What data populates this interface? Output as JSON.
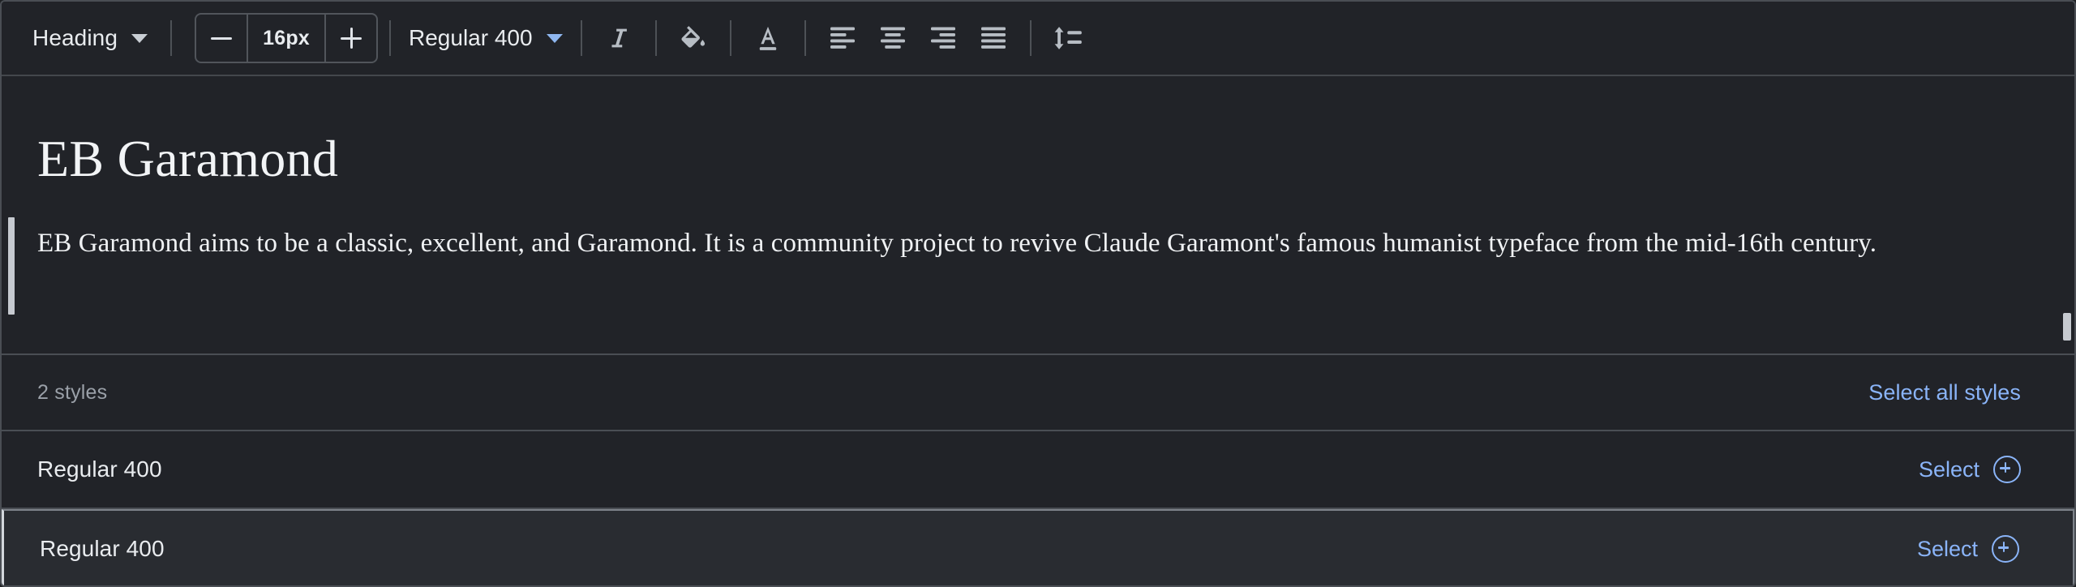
{
  "toolbar": {
    "paragraph_style": {
      "label": "Heading",
      "caret_icon": "chevron-down-icon"
    },
    "font_size": {
      "decrease_icon": "minus-icon",
      "value": "16px",
      "increase_icon": "plus-icon"
    },
    "font_weight": {
      "label": "Regular 400",
      "caret_icon": "chevron-down-icon"
    },
    "italic": {
      "icon": "italic-icon",
      "title": "Italic"
    },
    "highlight": {
      "icon": "fill-bucket-icon",
      "title": "Highlight color"
    },
    "text_color": {
      "icon": "text-color-a-icon",
      "title": "Text color"
    },
    "align_left": {
      "icon": "align-left-icon",
      "title": "Align left"
    },
    "align_center": {
      "icon": "align-center-icon",
      "title": "Align center"
    },
    "align_right": {
      "icon": "align-right-icon",
      "title": "Align right"
    },
    "align_justify": {
      "icon": "align-justify-icon",
      "title": "Justify"
    },
    "line_height": {
      "icon": "line-height-icon",
      "title": "Line spacing"
    }
  },
  "preview": {
    "font_name": "EB Garamond",
    "description": "EB Garamond aims to be a classic, excellent, and Garamond.  It is a community project to revive Claude Garamont's famous humanist typeface from the mid-16th century."
  },
  "styles_header": {
    "count_label": "2 styles",
    "select_all_label": "Select all styles"
  },
  "styles": [
    {
      "name": "Regular 400",
      "select_label": "Select",
      "select_icon": "plus-circle-icon",
      "focused": false
    },
    {
      "name": "Regular 400",
      "select_label": "Select",
      "select_icon": "plus-circle-icon",
      "focused": true
    }
  ],
  "colors": {
    "background": "#212328",
    "link": "#8ab4f8",
    "border": "#4a4e54",
    "text": "#e9ecef",
    "muted": "#9aa0a8",
    "focused_row_bg": "#292c31"
  }
}
